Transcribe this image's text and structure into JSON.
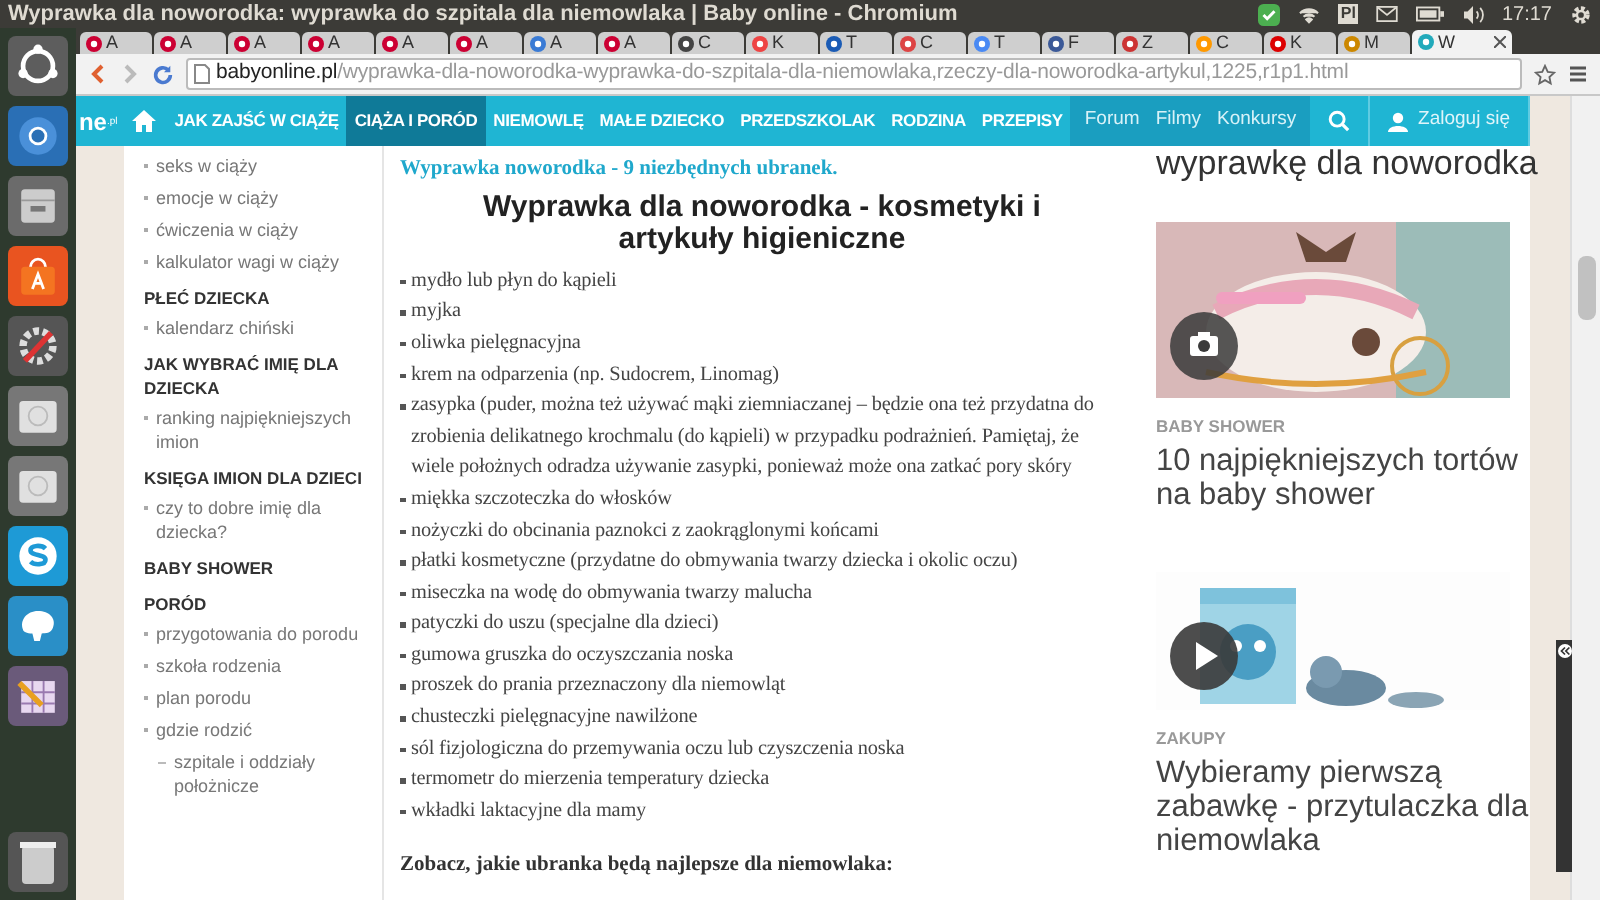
{
  "top_panel": {
    "title": "Wyprawka dla noworodka: wyprawka do szpitala dla niemowlaka | Baby online - Chromium",
    "keyboard_layout": "Pl",
    "time": "17:17"
  },
  "tabs": [
    {
      "label": "A",
      "selected": false
    },
    {
      "label": "A",
      "selected": false
    },
    {
      "label": "A",
      "selected": false
    },
    {
      "label": "A",
      "selected": false
    },
    {
      "label": "A",
      "selected": false
    },
    {
      "label": "A",
      "selected": false
    },
    {
      "label": "A",
      "selected": false
    },
    {
      "label": "A",
      "selected": false
    },
    {
      "label": "C",
      "selected": false
    },
    {
      "label": "K",
      "selected": false
    },
    {
      "label": "T",
      "selected": false
    },
    {
      "label": "C",
      "selected": false
    },
    {
      "label": "T",
      "selected": false
    },
    {
      "label": "F",
      "selected": false
    },
    {
      "label": "Z",
      "selected": false
    },
    {
      "label": "C",
      "selected": false
    },
    {
      "label": "K",
      "selected": false
    },
    {
      "label": "M",
      "selected": false
    },
    {
      "label": "W",
      "selected": true
    }
  ],
  "address_bar": {
    "domain": "babyonline.pl",
    "path": "/wyprawka-dla-noworodka-wyprawka-do-szpitala-dla-niemowlaka,rzeczy-dla-noworodka-artykul,1225,r1p1.html"
  },
  "site_nav": {
    "logo": "ne",
    "logo_suffix": ".pl",
    "items": [
      {
        "label": "JAK ZAJŚĆ W CIĄŻĘ",
        "selected": false
      },
      {
        "label": "CIĄŻA I PORÓD",
        "selected": true
      },
      {
        "label": "NIEMOWLĘ",
        "selected": false
      },
      {
        "label": "MAŁE DZIECKO",
        "selected": false
      },
      {
        "label": "PRZEDSZKOLAK",
        "selected": false
      },
      {
        "label": "RODZINA",
        "selected": false
      },
      {
        "label": "PRZEPISY",
        "selected": false
      }
    ],
    "secondary": [
      "Forum",
      "Filmy",
      "Konkursy"
    ],
    "login": "Zaloguj się"
  },
  "sidebar": [
    {
      "items": [
        {
          "label": "seks w ciąży"
        },
        {
          "label": "emocje w ciąży"
        },
        {
          "label": "ćwiczenia w ciąży"
        },
        {
          "label": "kalkulator wagi w ciąży"
        }
      ]
    },
    {
      "heading": "PŁEĆ DZIECKA",
      "items": [
        {
          "label": "kalendarz chiński"
        }
      ]
    },
    {
      "heading": "JAK WYBRAĆ IMIĘ DLA DZIECKA",
      "items": [
        {
          "label": "ranking najpiękniejszych imion"
        }
      ]
    },
    {
      "heading": "KSIĘGA IMION DLA DZIECI",
      "items": [
        {
          "label": "czy to dobre imię dla dziecka?"
        }
      ]
    },
    {
      "heading": "BABY SHOWER"
    },
    {
      "heading": "PORÓD",
      "items": [
        {
          "label": "przygotowania do porodu"
        },
        {
          "label": "szkoła rodzenia"
        },
        {
          "label": "plan porodu"
        },
        {
          "label": "gdzie rodzić",
          "children": [
            {
              "label": "szpitale i oddziały położnicze"
            }
          ]
        }
      ]
    }
  ],
  "article": {
    "link": "Wyprawka noworodka - 9 niezbędnych ubranek.",
    "heading": "Wyprawka dla noworodka - kosmetyki i artykuły higieniczne",
    "list": [
      "mydło lub płyn do kąpieli",
      "myjka",
      "oliwka pielęgnacyjna",
      "krem na odparzenia (np. Sudocrem, Linomag)",
      "zasypka (puder, można też używać mąki ziemniaczanej – będzie ona też przydatna do zrobienia delikatnego krochmalu (do kąpieli) w przypadku podrażnień. Pamiętaj, że wiele położnych odradza używanie zasypki, ponieważ może ona zatkać pory skóry",
      "miękka szczoteczka do włosków",
      "nożyczki do obcinania paznokci z zaokrąglonymi końcami",
      "płatki kosmetyczne (przydatne do obmywania twarzy dziecka i okolic oczu)",
      "miseczka na wodę do obmywania twarzy malucha",
      "patyczki do uszu (specjalne dla dzieci)",
      "gumowa gruszka do oczyszczania noska",
      "proszek do prania przeznaczony dla niemowląt",
      "chusteczki pielęgnacyjne nawilżone",
      "sól fizjologiczna do przemywania oczu lub czyszczenia noska",
      "termometr do mierzenia temperatury dziecka",
      "wkładki laktacyjne dla mamy"
    ],
    "subheading": "Zobacz, jakie ubranka będą najlepsze dla niemowlaka:"
  },
  "related": {
    "cut_title": "wyprawkę dla noworodka",
    "cards": [
      {
        "category": "BABY SHOWER",
        "title": "10 najpiękniejszych tortów na baby shower"
      },
      {
        "kind": "video",
        "category": "ZAKUPY",
        "title": "Wybieramy pierwszą zabawkę - przytulaczka dla niemowlaka"
      }
    ]
  }
}
